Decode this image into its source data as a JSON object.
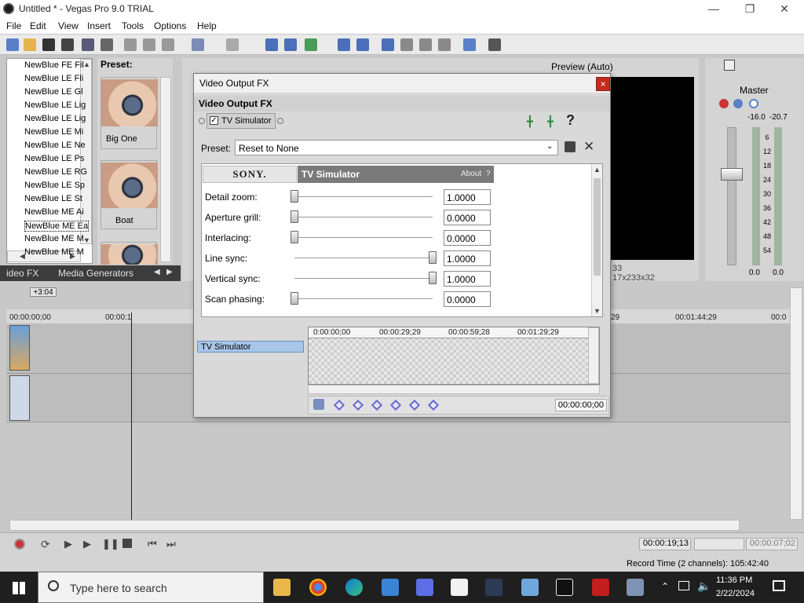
{
  "window": {
    "title": "Untitled * - Vegas Pro 9.0 TRIAL"
  },
  "menu": [
    "File",
    "Edit",
    "View",
    "Insert",
    "Tools",
    "Options",
    "Help"
  ],
  "fx_list": {
    "items": [
      "NewBlue FE Fil",
      "NewBlue LE Fli",
      "NewBlue LE Gl",
      "NewBlue LE Lig",
      "NewBlue LE Lig",
      "NewBlue LE Mi",
      "NewBlue LE Ne",
      "NewBlue LE Ps",
      "NewBlue LE RG",
      "NewBlue LE Sp",
      "NewBlue LE St",
      "NewBlue ME Ai",
      "NewBlue ME Ea",
      "NewBlue ME M",
      "NewBlue ME M"
    ],
    "selected_index": 12
  },
  "preset_panel": {
    "label": "Preset:",
    "presets": [
      "Big One",
      "Boat"
    ]
  },
  "bottom_tabs": [
    "ideo FX",
    "Media Generators"
  ],
  "preview": {
    "label": "Preview (Auto)",
    "info_a": "33",
    "info_b": "17x233x32"
  },
  "master": {
    "label": "Master",
    "peaks": [
      "-16.0",
      "-20.7"
    ],
    "scale": [
      "6",
      "12",
      "18",
      "24",
      "30",
      "36",
      "42",
      "48",
      "54"
    ],
    "levels": [
      "0.0",
      "0.0"
    ]
  },
  "timeline": {
    "marker": "+3:04",
    "ruler": [
      "00:00:00;00",
      "00:00:1",
      "29",
      "00:01:44;29",
      "00:0"
    ]
  },
  "transport": {
    "time_a": "00:00:19;13",
    "time_b": "00:00:07;02"
  },
  "status": {
    "record_time": "Record Time (2 channels): 105:42:40"
  },
  "dialog": {
    "title": "Video Output FX",
    "subtitle": "Video Output FX",
    "chain_fx": "TV Simulator",
    "preset_label": "Preset:",
    "preset_value": "Reset to None",
    "brand": "SONY.",
    "plugin_name": "TV Simulator",
    "about": "About",
    "params": [
      {
        "label": "Detail zoom:",
        "value": "1.0000",
        "fraction": 0.0
      },
      {
        "label": "Aperture grill:",
        "value": "0.0000",
        "fraction": 0.0
      },
      {
        "label": "Interlacing:",
        "value": "0.0000",
        "fraction": 0.0
      },
      {
        "label": "Line sync:",
        "value": "1.0000",
        "fraction": 1.0
      },
      {
        "label": "Vertical sync:",
        "value": "1.0000",
        "fraction": 1.0
      },
      {
        "label": "Scan phasing:",
        "value": "0.0000",
        "fraction": 0.0
      }
    ],
    "keyframe_track": "TV Simulator",
    "kf_ruler": [
      "0:00:00;00",
      "00:00:29;29",
      "00:00:59;28",
      "00:01:29;29"
    ],
    "kf_time": "00:00:00;00"
  },
  "taskbar": {
    "search_placeholder": "Type here to search",
    "time": "11:36 PM",
    "date": "2/22/2024"
  }
}
